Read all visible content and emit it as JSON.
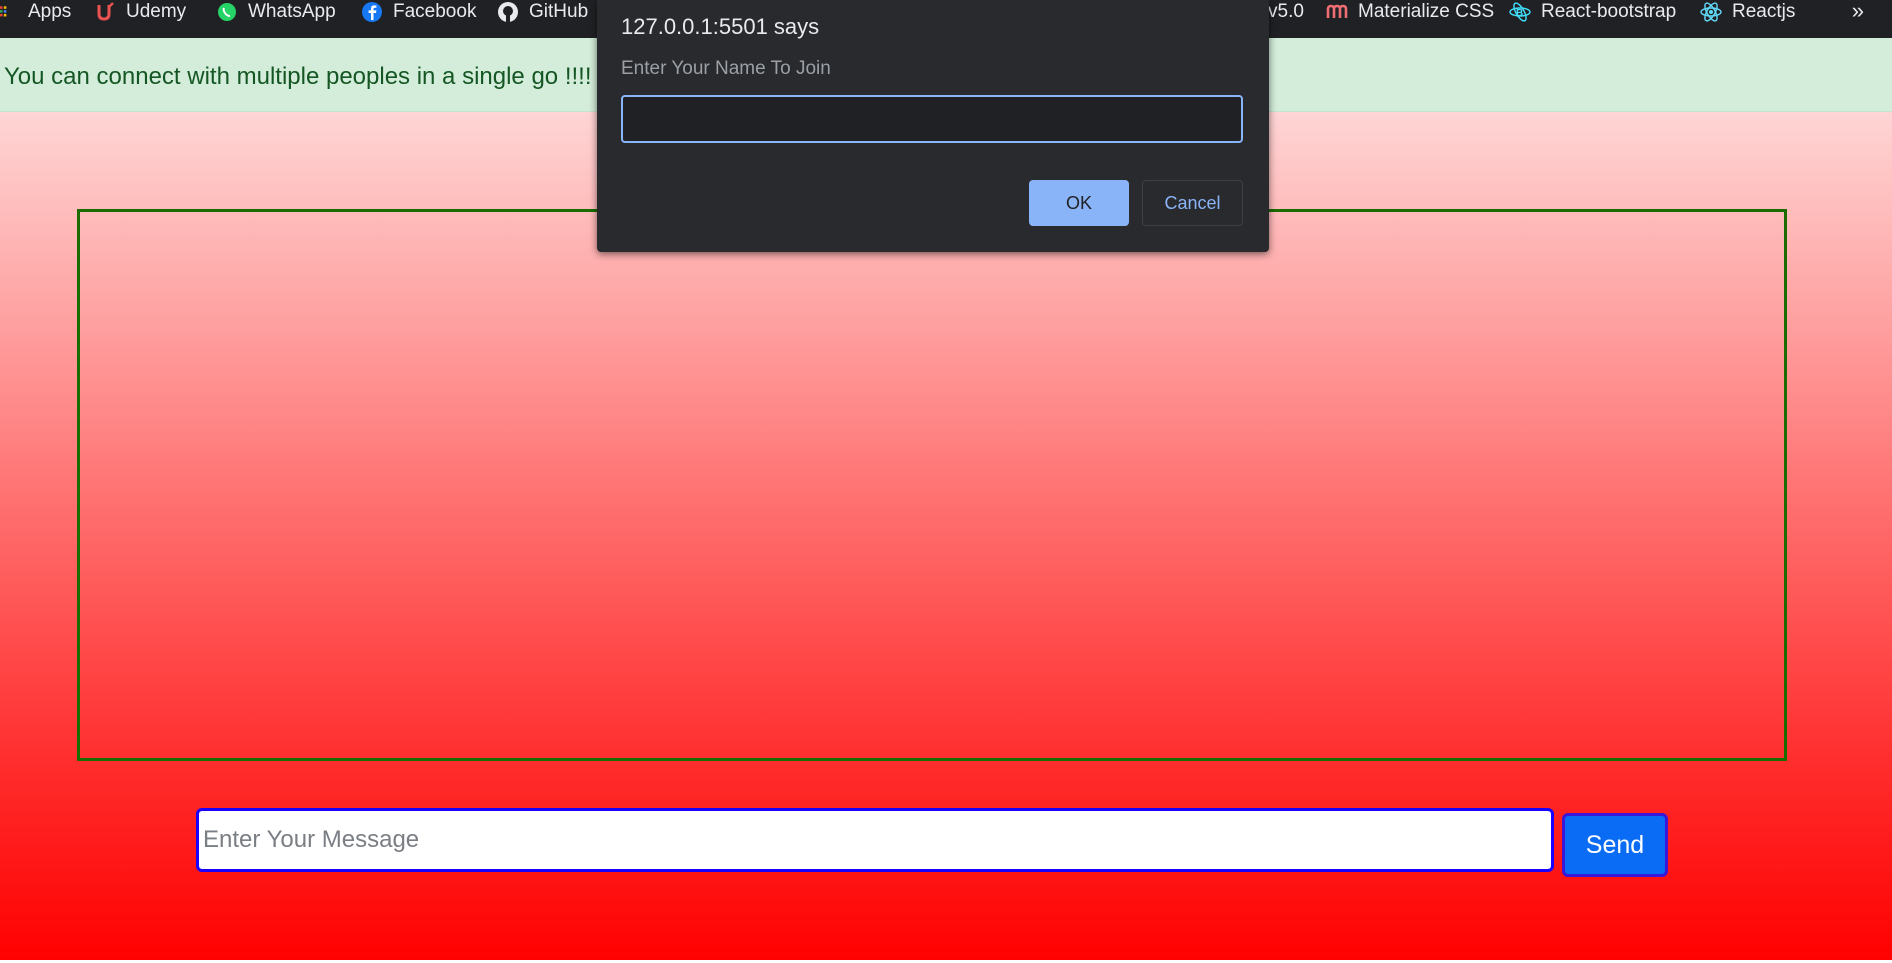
{
  "bookmarks": {
    "apps": "Apps",
    "udemy": "Udemy",
    "whatsapp": "WhatsApp",
    "facebook": "Facebook",
    "github": "GitHub",
    "bootstrap_partial": "v5.0",
    "materialize": "Materialize CSS",
    "react_bootstrap": "React-bootstrap",
    "reactjs": "Reactjs",
    "overflow": "»"
  },
  "alert": {
    "text": "You can connect with multiple peoples in a single go !!!!"
  },
  "composer": {
    "placeholder": "Enter Your Message",
    "value": "",
    "send_label": "Send"
  },
  "dialog": {
    "title": "127.0.0.1:5501 says",
    "message": "Enter Your Name To Join",
    "input_value": "",
    "ok_label": "OK",
    "cancel_label": "Cancel"
  },
  "colors": {
    "alert_bg": "#d4edda",
    "alert_text": "#155724",
    "chat_border": "#1a6b00",
    "input_border": "#1b00ff",
    "send_bg": "#0a6cf5",
    "dialog_bg": "#292a2d",
    "dialog_accent": "#8ab4f8"
  }
}
